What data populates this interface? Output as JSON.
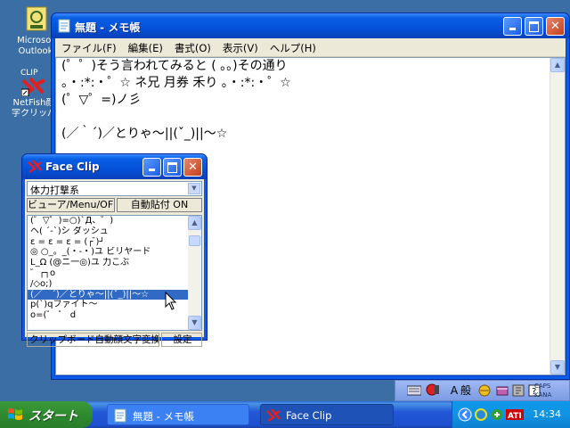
{
  "desktop": {
    "icons": [
      {
        "label_line1": "Microsof",
        "label_line2": "Outlook",
        "icon": "outlook-icon"
      },
      {
        "badge": "CLIP",
        "label_line1": "NetFish顔",
        "label_line2": "字クリッパ",
        "icon": "netfish-clip-icon"
      }
    ]
  },
  "notepad": {
    "title": "無題 - メモ帳",
    "menu": [
      "ファイル(F)",
      "編集(E)",
      "書式(O)",
      "表示(V)",
      "ヘルプ(H)"
    ],
    "lines": [
      "(゜゜)そう言われてみると ( 。。)その通り",
      "。・:*:・゜☆ ネ兄 月券 禾り 。・:*:・゜☆",
      "(゜▽゜=)ノ彡",
      "",
      "(／｀´)／とりゃ～||(ˇ_)||～☆"
    ]
  },
  "faceclip": {
    "title": "Face Clip",
    "category": "体力打撃系",
    "viewer_button": "ビューア/Menu/OFF",
    "autopaste_button": "自動貼付 ON",
    "list": [
      "(゜▽゜)=○)`Д、゜)",
      "ヘ( ´-`)シ ダッシュ",
      "ε = ε = ε = (┌ ̄)┘",
      "◎ ○_。_(・-・)ユ ビリヤード",
      "L_Ω (@ニ一◎)ユ 力こぶ",
      "゜┌┐o",
      "/◇o;)",
      "(／｀´)／とりゃ～||(ˇ_)||～☆",
      "p(`)qファイト～",
      "o=(゜ ゜ d"
    ],
    "selected_index": 7,
    "status_left": "クリップボード自動顔文字変換",
    "status_right": "設定"
  },
  "langbar": {
    "ime_mode": "A",
    "ime_kanji": "般",
    "caps": "CAPS",
    "kana": "KANA"
  },
  "taskbar": {
    "start_label": "スタート",
    "tasks": [
      {
        "label": "無題 - メモ帳",
        "active": false
      },
      {
        "label": "Face Clip",
        "active": true
      }
    ],
    "clock": "14:34"
  },
  "colors": {
    "desktop": "#3a6ea5",
    "titlebar": "#0451d8",
    "selection": "#316ac5",
    "close_button": "#c2401c",
    "taskbar": "#2157d7",
    "start_button": "#2e8a2e"
  }
}
